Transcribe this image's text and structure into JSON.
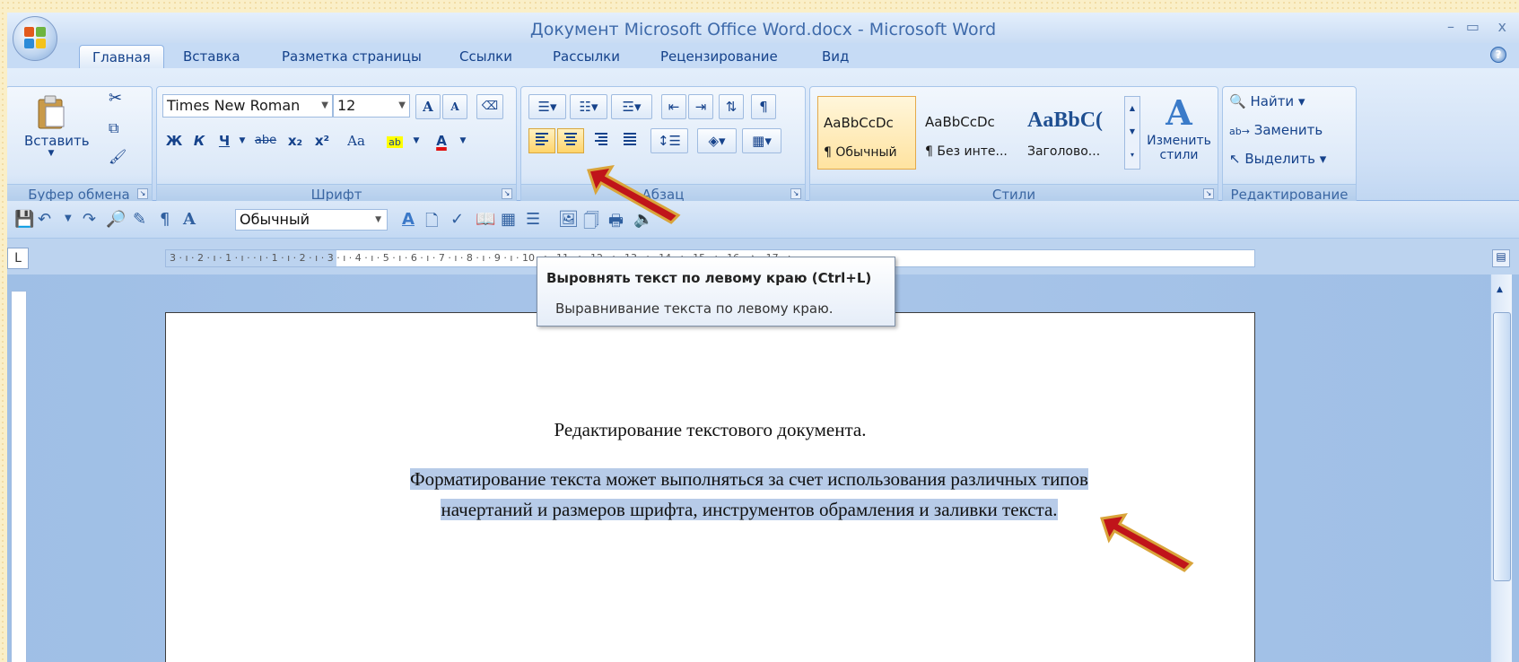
{
  "window": {
    "title": "Документ Microsoft Office Word.docx - Microsoft Word",
    "minimize": "–",
    "restore": "▭",
    "close": "x"
  },
  "tabs": [
    "Главная",
    "Вставка",
    "Разметка страницы",
    "Ссылки",
    "Рассылки",
    "Рецензирование",
    "Вид"
  ],
  "ribbon": {
    "clipboard": {
      "paste": "Вставить",
      "label": "Буфер обмена"
    },
    "font": {
      "name": "Times New Roman",
      "size": "12",
      "grow": "A",
      "shrink": "A",
      "bold": "Ж",
      "italic": "К",
      "underline": "Ч",
      "strike": "abe",
      "sub": "x₂",
      "sup": "x²",
      "case": "Aa",
      "label": "Шрифт"
    },
    "paragraph": {
      "label": "Абзац"
    },
    "styles": {
      "items": [
        {
          "sample": "AaBbCcDc",
          "name": "¶ Обычный"
        },
        {
          "sample": "AaBbCcDc",
          "name": "¶ Без инте..."
        },
        {
          "sample": "AaBbC(",
          "name": "Заголово..."
        }
      ],
      "change": "Изменить",
      "change2": "стили",
      "label": "Стили"
    },
    "editing": {
      "find": "Найти",
      "replace": "Заменить",
      "select": "Выделить",
      "label": "Редактирование"
    }
  },
  "qat": {
    "style": "Обычный"
  },
  "ruler": {
    "text": "3 · ı · 2 · ı · 1 · ı ·  · ı · 1 · ı · 2 · ı · 3 · ı · 4 · ı · 5 · ı · 6 · ı · 7 · ı · 8 · ı · 9 · ı · 10 · ı · 11 · ı · 12 · ı · 13 · ı · 14 · ı · 15 · ı · 16 · △ · 17 · ı ·"
  },
  "tooltip": {
    "title": "Выровнять текст по левому краю (Ctrl+L)",
    "body": "Выравнивание текста по левому краю."
  },
  "document": {
    "title": "Редактирование текстового документа.",
    "para_line1": "Форматирование текста может выполняться за счет использования различных типов",
    "para_line2": "начертаний и размеров шрифта, инструментов обрамления и заливки текста."
  },
  "colors": {
    "arrow": "#c0141a",
    "arrow_outline": "#d9a43a"
  }
}
